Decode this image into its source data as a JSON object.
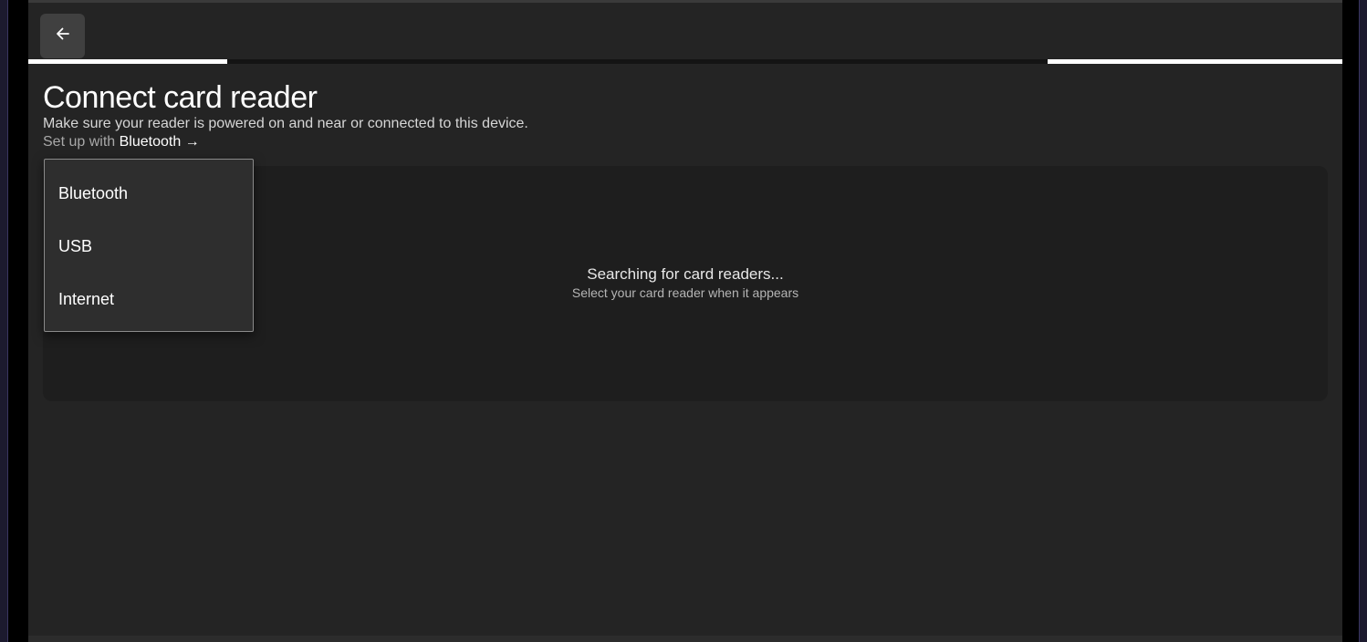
{
  "header": {
    "back_label": "Back"
  },
  "page": {
    "title": "Connect card reader",
    "subtitle": "Make sure your reader is powered on and near or connected to this device.",
    "setup_prefix": "Set up with",
    "setup_link": "Bluetooth →"
  },
  "connection_menu": {
    "options": [
      "Bluetooth",
      "USB",
      "Internet"
    ]
  },
  "search": {
    "title": "Searching for card readers...",
    "subtitle": "Select your card reader when it appears"
  },
  "colors": {
    "background": "#242424",
    "panel": "#1e1e1e",
    "accent": "#ffffff"
  }
}
